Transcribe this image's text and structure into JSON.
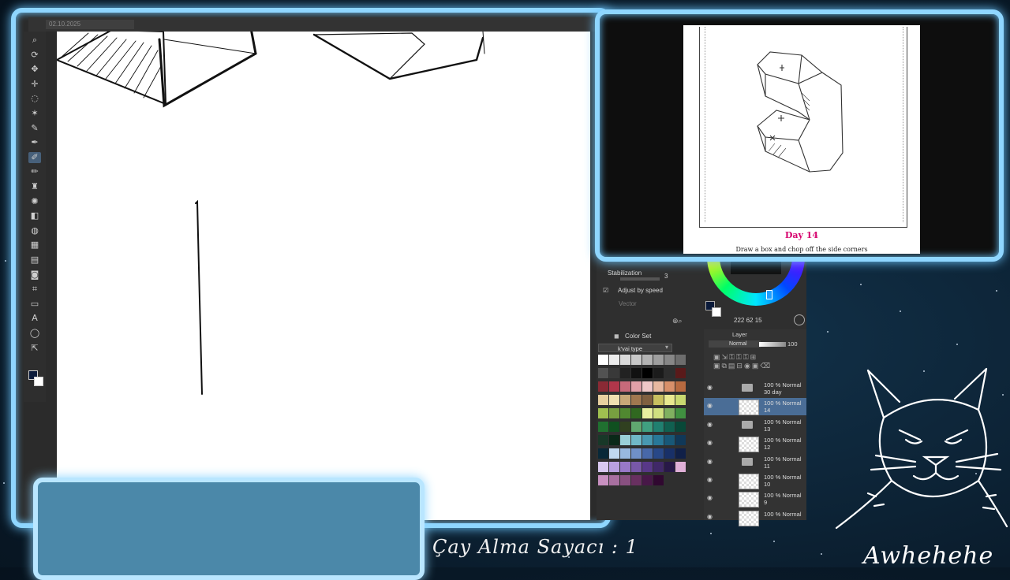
{
  "app": {
    "tab_label": "02.10.2025",
    "tool_glyphs": [
      "⌕",
      "⟳",
      "✥",
      "✛",
      "◌",
      "✶",
      "✎",
      "✒",
      "✐",
      "✏",
      "♜",
      "✺",
      "◧",
      "◍",
      "▦",
      "▤",
      "◙",
      "⌗",
      "▭",
      "A",
      "◯",
      "⇱"
    ]
  },
  "properties": {
    "stabilization_label": "Stabilization",
    "stabilization_value": "3",
    "adjust_by_speed_label": "Adjust by speed",
    "vector_label": "Vector"
  },
  "color": {
    "value_readout": "222  62  15"
  },
  "color_set": {
    "title": "Color Set",
    "dropdown_value": "k'vai type",
    "swatches": [
      "#ffffff",
      "#ededed",
      "#dadada",
      "#c7c7c7",
      "#b3b3b3",
      "#9e9e9e",
      "#878787",
      "#6d6d6d",
      "#525252",
      "#393939",
      "#222222",
      "#111111",
      "#000000",
      "#1b1b1b",
      "#2d2d2d",
      "#5a1a1a",
      "#8a2a35",
      "#b0364a",
      "#c76a7a",
      "#e1a0a8",
      "#f0c8c8",
      "#e8b8a0",
      "#d8906a",
      "#b86a40",
      "#e8d0a0",
      "#f0e0b0",
      "#c8a878",
      "#a07850",
      "#806040",
      "#c8c060",
      "#e8e890",
      "#c8d870",
      "#a0c050",
      "#78a040",
      "#508830",
      "#306820",
      "#e8f0a0",
      "#d0e080",
      "#80b060",
      "#409040",
      "#207030",
      "#105020",
      "#304020",
      "#60a870",
      "#40a080",
      "#208070",
      "#106050",
      "#084838",
      "#183828",
      "#0a2818",
      "#9ad0d8",
      "#70b8c8",
      "#4898b0",
      "#287898",
      "#185878",
      "#103858",
      "#082838",
      "#c0d8f0",
      "#98b8e0",
      "#7090c8",
      "#4868a8",
      "#284888",
      "#183068",
      "#102048",
      "#d8c8f0",
      "#b8a0e0",
      "#9878c8",
      "#7858a8",
      "#583888",
      "#402868",
      "#281848",
      "#e0b0d8",
      "#c890c0",
      "#a870a0",
      "#885080",
      "#683060",
      "#481848",
      "#300830"
    ]
  },
  "layers": {
    "title": "Layer",
    "blend_mode": "Normal",
    "opacity": "100",
    "rows": [
      {
        "line1": "100 % Normal",
        "line2": "30 day",
        "type": "folder"
      },
      {
        "line1": "100 % Normal",
        "line2": "14",
        "type": "layer"
      },
      {
        "line1": "100 % Normal",
        "line2": "13",
        "type": "folder"
      },
      {
        "line1": "100 % Normal",
        "line2": "12",
        "type": "layer"
      },
      {
        "line1": "100 % Normal",
        "line2": "11",
        "type": "folder"
      },
      {
        "line1": "100 % Normal",
        "line2": "10",
        "type": "layer"
      },
      {
        "line1": "100 % Normal",
        "line2": "9",
        "type": "layer"
      },
      {
        "line1": "100 % Normal",
        "line2": "",
        "type": "layer"
      }
    ]
  },
  "reference": {
    "day_title": "Day 14",
    "description": "Draw a box and chop off the side corners"
  },
  "overlay": {
    "counter_text": "Çay Alma Sayacı : 1",
    "mascot_caption": "Awhehehe"
  }
}
